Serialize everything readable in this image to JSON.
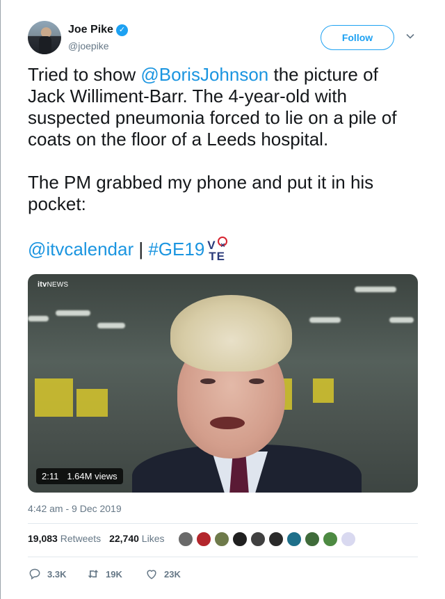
{
  "author": {
    "display_name": "Joe Pike",
    "handle": "@joepike",
    "follow_label": "Follow",
    "verified": true
  },
  "tweet": {
    "line1_pre": "Tried to show ",
    "mention": "@BorisJohnson",
    "line1_post": " the picture of Jack Williment-Barr. The 4-year-old with suspected pneumonia forced to lie on a pile of coats on the floor of a Leeds hospital.",
    "paragraph2": "The PM grabbed my phone and put it in his pocket:",
    "mention2": "@itvcalendar",
    "separator": " | ",
    "hashtag": "#GE19",
    "vote_v": "V",
    "vote_te": "TE"
  },
  "video": {
    "logo_brand": "itv",
    "logo_label": "NEWS",
    "duration": "2:11",
    "views": "1.64M views"
  },
  "timestamp": "4:42 am - 9 Dec 2019",
  "stats": {
    "retweets_count": "19,083",
    "retweets_label": "Retweets",
    "likes_count": "22,740",
    "likes_label": "Likes"
  },
  "likers_colors": [
    "#6a6a6a",
    "#b3262c",
    "#6e7a4a",
    "#202020",
    "#404040",
    "#2a2a2a",
    "#1e6f8a",
    "#3f6b3a",
    "#4d8a42",
    "#d9d9f0"
  ],
  "actions": {
    "reply_count": "3.3K",
    "retweet_count": "19K",
    "like_count": "23K"
  },
  "colors": {
    "link": "#1b95e0",
    "follow": "#1da1f2",
    "muted": "#657786"
  }
}
